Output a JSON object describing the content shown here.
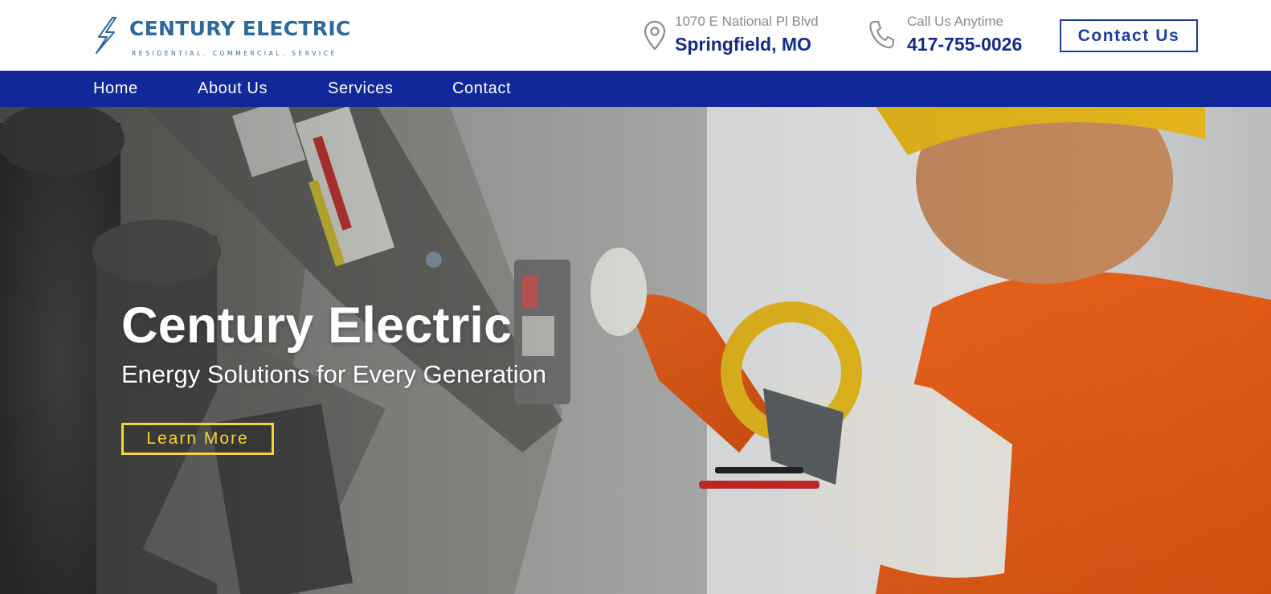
{
  "brand": {
    "name": "CENTURY ELECTRIC",
    "tagline": "RESIDENTIAL. COMMERCIAL. SERVICE",
    "logo_icon": "lightning-bolt-icon",
    "color": "#2a6a9e"
  },
  "header": {
    "address": {
      "icon": "map-pin-icon",
      "label": "1070 E National Pl Blvd",
      "value": "Springfield, MO"
    },
    "phone": {
      "icon": "phone-icon",
      "label": "Call Us Anytime",
      "value": "417-755-0026"
    },
    "contact_button": "Contact Us"
  },
  "nav": {
    "items": [
      {
        "label": "Home"
      },
      {
        "label": "About Us"
      },
      {
        "label": "Services"
      },
      {
        "label": "Contact"
      }
    ],
    "background": "#10299a"
  },
  "hero": {
    "title": "Century Electric",
    "subtitle": "Energy Solutions for Every Generation",
    "button": "Learn More",
    "accent": "#f5d437"
  }
}
